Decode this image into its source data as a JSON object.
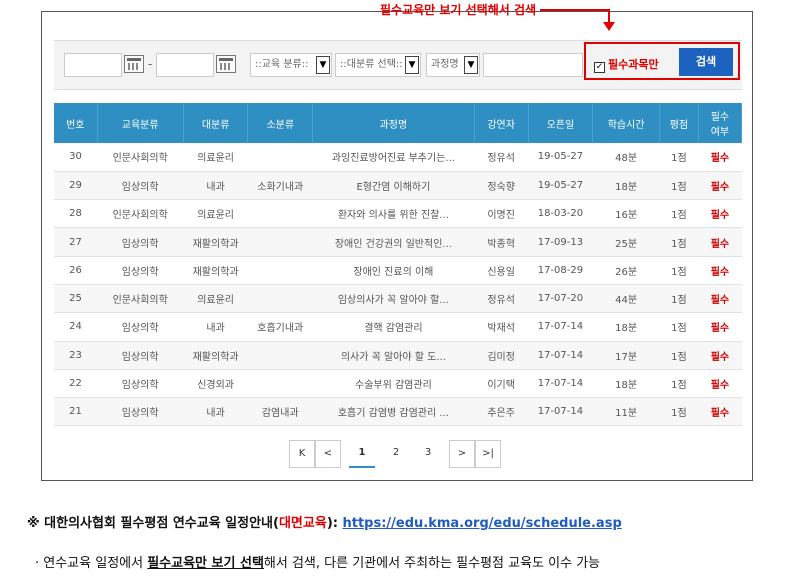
{
  "callout": "필수교육만 보기 선택해서 검색",
  "filters": {
    "category_placeholder": "::교육 분류::",
    "major_placeholder": "::대분류 선택::",
    "search_type": "과정명",
    "required_only_label": "필수과목만",
    "required_only_checked": true,
    "search_button": "검색"
  },
  "table": {
    "headers": [
      "번호",
      "교육분류",
      "대분류",
      "소분류",
      "과정명",
      "강연자",
      "오픈일",
      "학습시간",
      "평점",
      "필수\n여부"
    ],
    "rows": [
      [
        "30",
        "인문사회의학",
        "의료윤리",
        "",
        "과잉진료방어진료 부추기는...",
        "정유석",
        "19-05-27",
        "48분",
        "1점",
        "필수"
      ],
      [
        "29",
        "임상의학",
        "내과",
        "소화기내과",
        "E형간염 이해하기",
        "정숙향",
        "19-05-27",
        "18분",
        "1점",
        "필수"
      ],
      [
        "28",
        "인문사회의학",
        "의료윤리",
        "",
        "환자와 의사를 위한 진찰...",
        "이명진",
        "18-03-20",
        "16분",
        "1점",
        "필수"
      ],
      [
        "27",
        "임상의학",
        "재활의학과",
        "",
        "장애인 건강권의 일반적인...",
        "박종혁",
        "17-09-13",
        "25분",
        "1점",
        "필수"
      ],
      [
        "26",
        "임상의학",
        "재활의학과",
        "",
        "장애인 진료의 이해",
        "신용일",
        "17-08-29",
        "26분",
        "1점",
        "필수"
      ],
      [
        "25",
        "인문사회의학",
        "의료윤리",
        "",
        "임상의사가 꼭 알아야 할...",
        "정유석",
        "17-07-20",
        "44분",
        "1점",
        "필수"
      ],
      [
        "24",
        "임상의학",
        "내과",
        "호흡기내과",
        "결핵 감염관리",
        "박재석",
        "17-07-14",
        "18분",
        "1점",
        "필수"
      ],
      [
        "23",
        "임상의학",
        "재활의학과",
        "",
        "의사가 꼭 알아야 할 도...",
        "김미정",
        "17-07-14",
        "17분",
        "1점",
        "필수"
      ],
      [
        "22",
        "임상의학",
        "신경외과",
        "",
        "수술부위 감염관리",
        "이기택",
        "17-07-14",
        "18분",
        "1점",
        "필수"
      ],
      [
        "21",
        "임상의학",
        "내과",
        "감염내과",
        "호흡기 감염병 감염관리 ...",
        "추은주",
        "17-07-14",
        "11분",
        "1점",
        "필수"
      ]
    ]
  },
  "pager": {
    "first": "K",
    "prev": "<",
    "pages": [
      "1",
      "2",
      "3"
    ],
    "current": "1",
    "next": ">",
    "last": ">|"
  },
  "notice": {
    "prefix": "※ 대한의사협회 필수평점 연수교육 일정안내(",
    "red": "대면교육",
    "suffix": "): ",
    "link": "https://edu.kma.org/edu/schedule.asp"
  },
  "bullet": {
    "pre": "· 연수교육 일정에서 ",
    "underlined": "필수교육만 보기 선택",
    "post": "해서 검색, 다른 기관에서 주최하는 필수평점 교육도 이수 가능"
  },
  "colors": {
    "accent": "#e00000",
    "header": "#2f8fc2",
    "button": "#1e62c0"
  }
}
